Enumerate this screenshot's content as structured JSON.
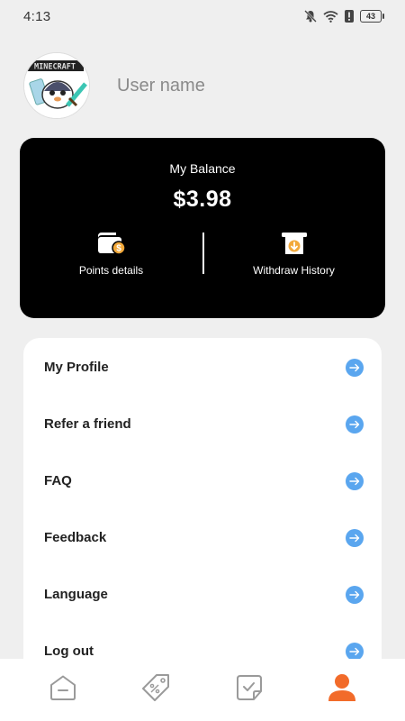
{
  "status_bar": {
    "time": "4:13",
    "battery": "43",
    "icons": [
      "bell-muted-icon",
      "wifi-icon",
      "alert-icon",
      "battery-icon"
    ]
  },
  "profile": {
    "avatar_caption": "MINECRAFT",
    "username": "User name"
  },
  "balance": {
    "label": "My Balance",
    "value": "$3.98",
    "actions": [
      {
        "label": "Points details",
        "icon": "wallet-icon"
      },
      {
        "label": "Withdraw History",
        "icon": "withdraw-icon"
      }
    ]
  },
  "menu": {
    "items": [
      {
        "label": "My Profile"
      },
      {
        "label": "Refer a friend"
      },
      {
        "label": "FAQ"
      },
      {
        "label": "Feedback"
      },
      {
        "label": "Language"
      },
      {
        "label": "Log out"
      }
    ]
  },
  "bottom_nav": {
    "items": [
      {
        "icon": "home-icon"
      },
      {
        "icon": "coupon-tag-icon"
      },
      {
        "icon": "task-check-icon"
      },
      {
        "icon": "user-icon"
      }
    ]
  },
  "colors": {
    "accent_orange": "#f26b2a",
    "arrow_blue": "#5aa6ef",
    "card_black": "#000000",
    "background": "#efefef"
  }
}
